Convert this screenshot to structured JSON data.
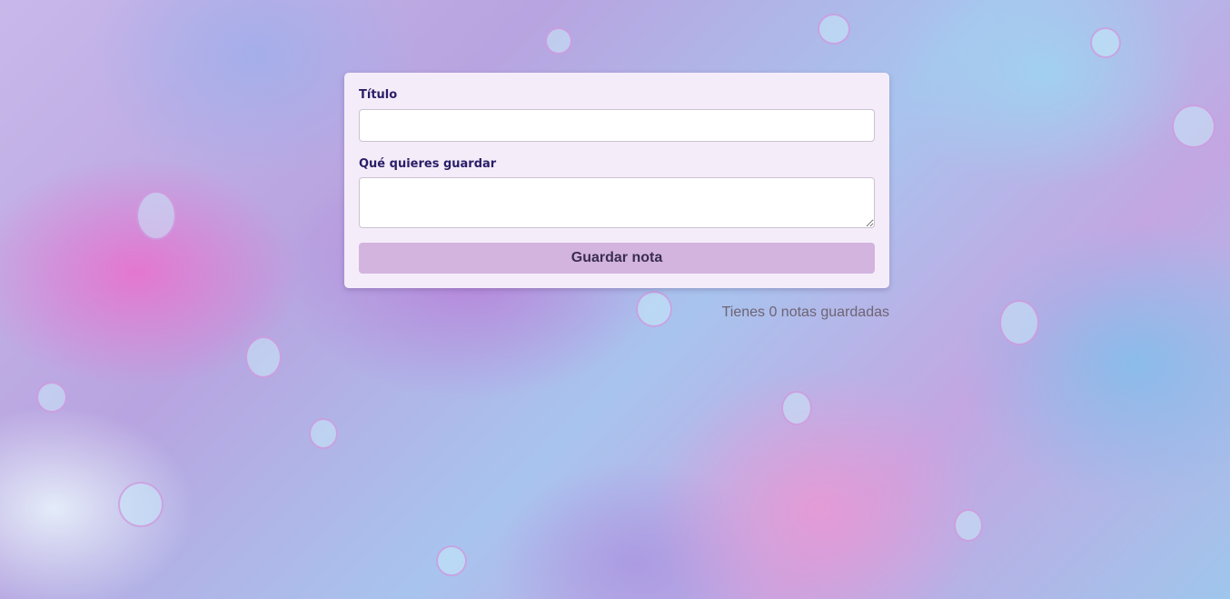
{
  "form": {
    "title_label": "Título",
    "title_value": "",
    "content_label": "Qué quieres guardar",
    "content_value": "",
    "save_label": "Guardar nota"
  },
  "status": {
    "notes_count_text": "Tienes 0 notas guardadas"
  },
  "colors": {
    "card_background": "#f5ecfa",
    "label_text": "#2a1f66",
    "button_background": "#d3b4de",
    "button_text": "#3a2d52",
    "status_text": "#6e6474"
  }
}
